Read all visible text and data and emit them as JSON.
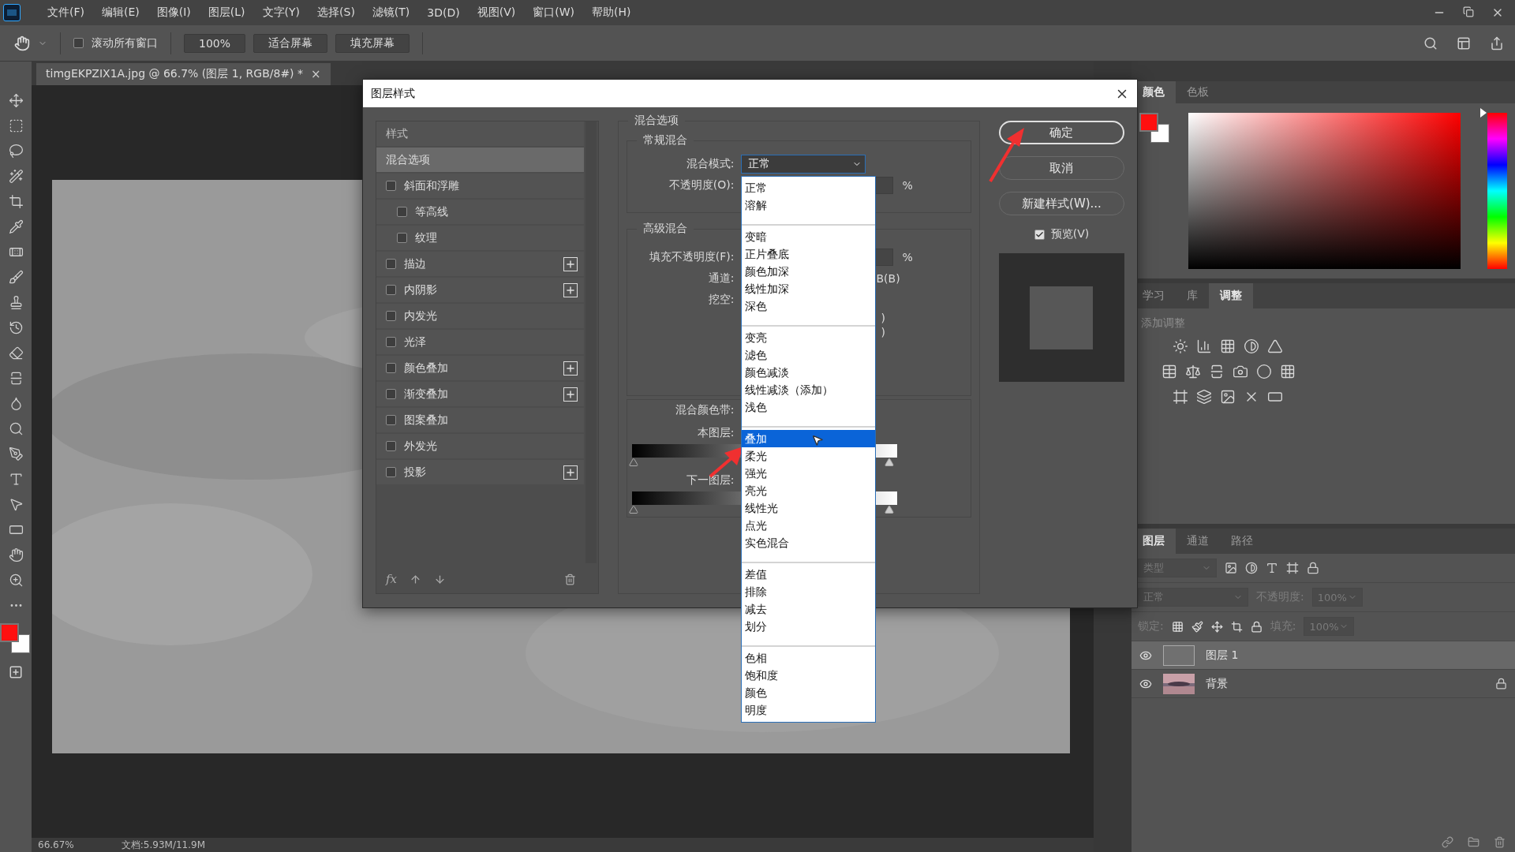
{
  "menu_bar": {
    "items": [
      "文件(F)",
      "编辑(E)",
      "图像(I)",
      "图层(L)",
      "文字(Y)",
      "选择(S)",
      "滤镜(T)",
      "3D(D)",
      "视图(V)",
      "窗口(W)",
      "帮助(H)"
    ]
  },
  "options_bar": {
    "scroll_all": {
      "label": "滚动所有窗口",
      "checked": false
    },
    "buttons": [
      "100%",
      "适合屏幕",
      "填充屏幕"
    ]
  },
  "document_tab": {
    "title": "timgEKPZIX1A.jpg @ 66.7% (图层 1, RGB/8#) *",
    "close": "×"
  },
  "status_bar": {
    "zoom": "66.67%",
    "doc_size": "文档:5.93M/11.9M"
  },
  "dialog": {
    "title": "图层样式",
    "styles": {
      "header": "样式",
      "footer_label": "fx",
      "items": [
        {
          "label": "混合选项",
          "kind": "section",
          "selected": true
        },
        {
          "label": "斜面和浮雕",
          "kind": "effect",
          "selected": false,
          "checked": false,
          "add": false,
          "children": [
            {
              "label": "等高线",
              "kind": "effect",
              "selected": false,
              "checked": false,
              "add": false
            },
            {
              "label": "纹理",
              "kind": "effect",
              "selected": false,
              "checked": false,
              "add": false
            }
          ]
        },
        {
          "label": "描边",
          "kind": "effect",
          "selected": false,
          "checked": false,
          "add": true
        },
        {
          "label": "内阴影",
          "kind": "effect",
          "selected": false,
          "checked": false,
          "add": true
        },
        {
          "label": "内发光",
          "kind": "effect",
          "selected": false,
          "checked": false,
          "add": false
        },
        {
          "label": "光泽",
          "kind": "effect",
          "selected": false,
          "checked": false,
          "add": false
        },
        {
          "label": "颜色叠加",
          "kind": "effect",
          "selected": false,
          "checked": false,
          "add": true
        },
        {
          "label": "渐变叠加",
          "kind": "effect",
          "selected": false,
          "checked": false,
          "add": true
        },
        {
          "label": "图案叠加",
          "kind": "effect",
          "selected": false,
          "checked": false,
          "add": false
        },
        {
          "label": "外发光",
          "kind": "effect",
          "selected": false,
          "checked": false,
          "add": false
        },
        {
          "label": "投影",
          "kind": "effect",
          "selected": false,
          "checked": false,
          "add": true
        }
      ]
    },
    "blend": {
      "title": "混合选项",
      "general_title": "常规混合",
      "mode_label": "混合模式:",
      "mode_value": "正常",
      "opacity_label": "不透明度(O):",
      "opacity_unit": "%",
      "advanced_title": "高级混合",
      "fill_label": "填充不透明度(F):",
      "fill_unit": "%",
      "channels_label": "通道:",
      "channels_fragment": "B(B)",
      "knockout_label": "挖空:",
      "fragments": [
        ")",
        ")"
      ],
      "band_label": "混合颜色带:",
      "this_layer": "本图层:",
      "underlying": "下一图层:"
    },
    "mode_menu": [
      [
        {
          "label": "正常",
          "selected": false
        },
        {
          "label": "溶解",
          "selected": false
        }
      ],
      [
        {
          "label": "变暗",
          "selected": false
        },
        {
          "label": "正片叠底",
          "selected": false
        },
        {
          "label": "颜色加深",
          "selected": false
        },
        {
          "label": "线性加深",
          "selected": false
        },
        {
          "label": "深色",
          "selected": false
        }
      ],
      [
        {
          "label": "变亮",
          "selected": false
        },
        {
          "label": "滤色",
          "selected": false
        },
        {
          "label": "颜色减淡",
          "selected": false
        },
        {
          "label": "线性减淡（添加）",
          "selected": false
        },
        {
          "label": "浅色",
          "selected": false
        }
      ],
      [
        {
          "label": "叠加",
          "selected": true
        },
        {
          "label": "柔光",
          "selected": false
        },
        {
          "label": "强光",
          "selected": false
        },
        {
          "label": "亮光",
          "selected": false
        },
        {
          "label": "线性光",
          "selected": false
        },
        {
          "label": "点光",
          "selected": false
        },
        {
          "label": "实色混合",
          "selected": false
        }
      ],
      [
        {
          "label": "差值",
          "selected": false
        },
        {
          "label": "排除",
          "selected": false
        },
        {
          "label": "减去",
          "selected": false
        },
        {
          "label": "划分",
          "selected": false
        }
      ],
      [
        {
          "label": "色相",
          "selected": false
        },
        {
          "label": "饱和度",
          "selected": false
        },
        {
          "label": "颜色",
          "selected": false
        },
        {
          "label": "明度",
          "selected": false
        }
      ]
    ],
    "buttons": [
      {
        "label": "确定",
        "kind": "primary"
      },
      {
        "label": "取消",
        "kind": "normal"
      },
      {
        "label": "新建样式(W)...",
        "kind": "normal"
      }
    ],
    "preview": {
      "label": "预览(V)",
      "checked": true
    }
  },
  "panels": {
    "color": {
      "hue": {
        "level": 1
      },
      "tabs": [
        {
          "label": "颜色",
          "selected": true
        },
        {
          "label": "色板",
          "selected": false
        }
      ]
    },
    "adjustments": {
      "tabs": [
        {
          "label": "学习",
          "selected": false
        },
        {
          "label": "库",
          "selected": false
        },
        {
          "label": "调整",
          "selected": true
        }
      ],
      "title": "添加调整"
    },
    "layers": {
      "tabs": [
        {
          "label": "图层",
          "selected": true
        },
        {
          "label": "通道",
          "selected": false
        },
        {
          "label": "路径",
          "selected": false
        }
      ],
      "filter_placeholder": "类型",
      "blend_mode": "正常",
      "opacity_label": "不透明度:",
      "opacity_value": "100%",
      "lock_label": "锁定:",
      "fill_label": "填充:",
      "fill_value": "100%",
      "items": [
        {
          "name": "图层 1",
          "kind": "plain",
          "selected": true,
          "visible": true,
          "locked": false
        },
        {
          "name": "背景",
          "kind": "picture",
          "selected": false,
          "visible": true,
          "locked": true
        }
      ]
    }
  }
}
